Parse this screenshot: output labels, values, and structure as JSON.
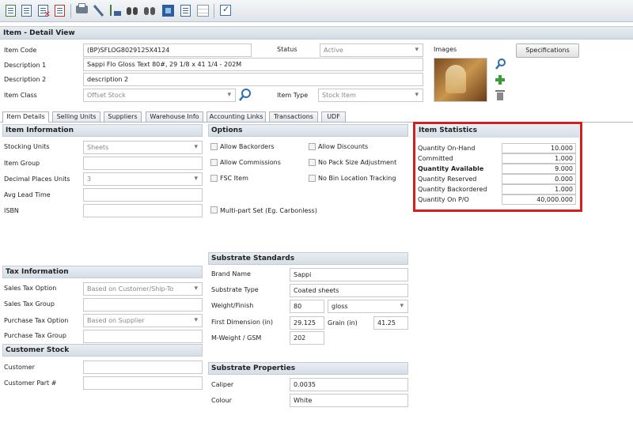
{
  "toolbar": {
    "icons": [
      "new-item-icon",
      "edit-icon",
      "delete-icon",
      "copy-icon",
      "print-icon",
      "tools-icon",
      "sort-icon",
      "find-icon",
      "find-next-icon",
      "export-icon",
      "report-icon",
      "grid-icon",
      "checkbox-icon"
    ]
  },
  "header": {
    "title": "Item - Detail View"
  },
  "form": {
    "item_code_label": "Item Code",
    "item_code_value": "(BP)SFLOG8029125X4124",
    "status_label": "Status",
    "status_value": "Active",
    "images_label": "Images",
    "specifications_button": "Specifications",
    "description_label": "Description 1",
    "description_value": "Sappi Flo Gloss Text 80#, 29 1/8 x 41 1/4 - 202M",
    "description2_label": "Description 2",
    "description2_value": "description 2",
    "item_class_label": "Item Class",
    "item_class_value": "Offset Stock",
    "item_type_label": "Item Type",
    "item_type_value": "Stock Item"
  },
  "tabs": [
    "Item Details",
    "Selling Units",
    "Suppliers",
    "Warehouse Info",
    "Accounting Links",
    "Transactions",
    "UDF"
  ],
  "item_information": {
    "title": "Item Information",
    "stocking_units_label": "Stocking Units",
    "stocking_units_value": "Sheets",
    "item_group_label": "Item Group",
    "decimal_places_label": "Decimal Places Units",
    "decimal_places_value": "3",
    "avg_lead_time_label": "Avg Lead Time",
    "isbn_label": "ISBN"
  },
  "options": {
    "title": "Options",
    "allow_backorders": "Allow Backorders",
    "allow_discounts": "Allow Discounts",
    "allow_commissions": "Allow Commissions",
    "no_pack_size": "No Pack Size Adjustment",
    "fsc_item": "FSC Item",
    "no_bin_location": "No Bin Location Tracking",
    "multipart_set": "Multi-part Set (Eg. Carbonless)"
  },
  "item_statistics": {
    "title": "Item Statistics",
    "rows": [
      {
        "label": "Quantity On-Hand",
        "value": "10.000"
      },
      {
        "label": "Committed",
        "value": "1.000"
      },
      {
        "label": "Quantity Available",
        "value": "9.000"
      },
      {
        "label": "Quantity Reserved",
        "value": "0.000"
      },
      {
        "label": "Quantity Backordered",
        "value": "1.000"
      },
      {
        "label": "Quantity On P/O",
        "value": "40,000.000"
      }
    ]
  },
  "tax_information": {
    "title": "Tax Information",
    "sales_tax_option_label": "Sales Tax Option",
    "sales_tax_option_value": "Based on Customer/Ship-To",
    "sales_tax_group_label": "Sales Tax Group",
    "purchase_tax_option_label": "Purchase Tax Option",
    "purchase_tax_option_value": "Based on Supplier",
    "purchase_tax_group_label": "Purchase Tax Group"
  },
  "customer_stock": {
    "title": "Customer Stock",
    "customer_label": "Customer",
    "customer_part_label": "Customer Part #"
  },
  "substrate_standards": {
    "title": "Substrate Standards",
    "brand_name_label": "Brand Name",
    "brand_name_value": "Sappi",
    "substrate_type_label": "Substrate Type",
    "substrate_type_value": "Coated sheets",
    "weight_finish_label": "Weight/Finish",
    "weight_value": "80",
    "finish_value": "gloss",
    "first_dimension_label": "First Dimension (in)",
    "first_dimension_value": "29.125",
    "grain_label": "Grain (in)",
    "grain_value": "41.25",
    "mweight_label": "M-Weight / GSM",
    "mweight_value": "202"
  },
  "substrate_properties": {
    "title": "Substrate Properties",
    "caliper_label": "Caliper",
    "caliper_value": "0.0035",
    "colour_label": "Colour",
    "colour_value": "White"
  },
  "colors": {
    "highlight_border": "#d21f1f",
    "section_header": "#d5dde6"
  }
}
